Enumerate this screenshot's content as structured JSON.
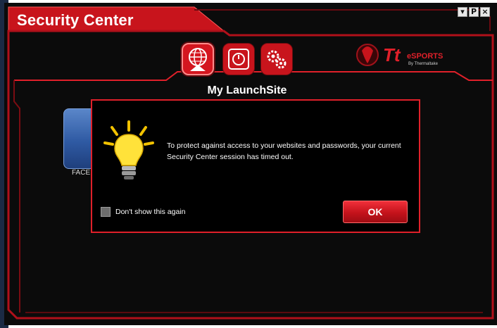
{
  "window": {
    "title": "Security Center",
    "controls": [
      "minimize-icon",
      "pin-icon",
      "close-icon"
    ]
  },
  "nav": {
    "items": [
      {
        "name": "launchsite",
        "icon": "globe-home-icon",
        "active": true
      },
      {
        "name": "vault",
        "icon": "safe-dial-icon",
        "active": false
      },
      {
        "name": "settings",
        "icon": "gears-icon",
        "active": false
      }
    ]
  },
  "brand": {
    "text": "Tt eSPORTS",
    "sub": "By Thermaltake"
  },
  "main": {
    "section_title": "My LaunchSite",
    "tiles": [
      {
        "label": "FACE"
      }
    ]
  },
  "dialog": {
    "message": "To protect against access to your websites and passwords, your current Security Center session has timed out.",
    "checkbox_label": "Don't show this again",
    "checkbox_checked": false,
    "ok_label": "OK"
  },
  "colors": {
    "accent": "#e0202a",
    "background": "#0b0b0b",
    "text": "#ffffff"
  }
}
